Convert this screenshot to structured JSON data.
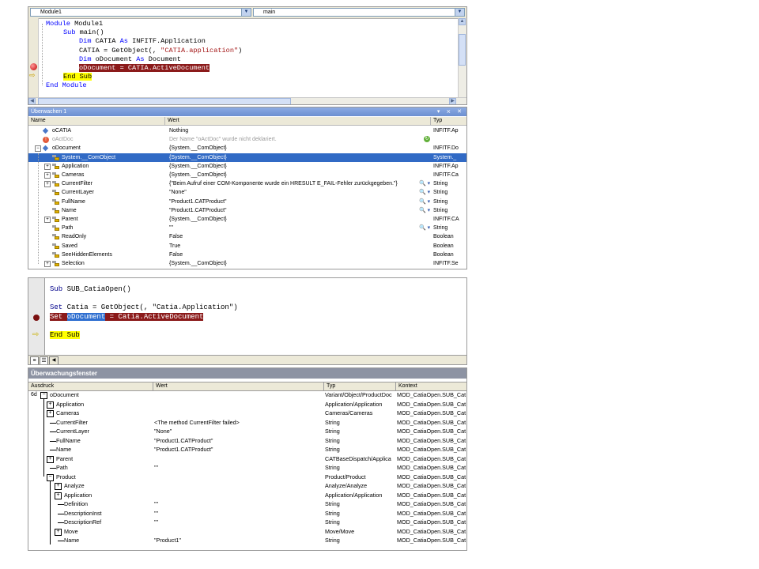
{
  "vs_editor": {
    "class_combo": "Module1",
    "method_combo": "main",
    "lines": [
      {
        "indent": 0,
        "parts": [
          [
            "kw",
            "Module"
          ],
          [
            "t",
            " Module1"
          ]
        ]
      },
      {
        "indent": 1,
        "parts": [
          [
            "kw",
            "Sub"
          ],
          [
            "t",
            " main()"
          ]
        ]
      },
      {
        "indent": 2,
        "parts": [
          [
            "kw",
            "Dim"
          ],
          [
            "t",
            " CATIA "
          ],
          [
            "kw",
            "As"
          ],
          [
            "t",
            " INFITF.Application"
          ]
        ]
      },
      {
        "indent": 2,
        "parts": [
          [
            "t",
            "CATIA = GetObject(, "
          ],
          [
            "str",
            "\"CATIA.application\""
          ],
          [
            "t",
            ")"
          ]
        ]
      },
      {
        "indent": 2,
        "parts": [
          [
            "kw",
            "Dim"
          ],
          [
            "t",
            " oDocument "
          ],
          [
            "kw",
            "As"
          ],
          [
            "t",
            " Document"
          ]
        ]
      },
      {
        "indent": 2,
        "parts": [
          [
            "bp",
            "oDocument = CATIA.ActiveDocument"
          ]
        ]
      },
      {
        "indent": 1,
        "parts": [
          [
            "cur",
            "End Sub"
          ]
        ]
      },
      {
        "indent": 0,
        "parts": [
          [
            "kw",
            "End Module"
          ]
        ]
      }
    ]
  },
  "watch1": {
    "title": "Überwachen 1",
    "title_icons": "▾ ⨯ ✕",
    "columns": {
      "name": "Name",
      "value": "Wert",
      "type": "Typ"
    },
    "rows": [
      {
        "level": 0,
        "expander": "",
        "icon": "obj",
        "name": "oCATIA",
        "value": "Nothing",
        "type": "INFITF.Ap",
        "gray": false,
        "sel": false,
        "mag": false
      },
      {
        "level": 0,
        "expander": "",
        "icon": "err",
        "name": "oActDoc",
        "value": "Der Name \"oActDoc\" wurde nicht deklariert.",
        "type": "",
        "gray": true,
        "sel": false,
        "mag": false,
        "refresh": true
      },
      {
        "level": 0,
        "expander": "−",
        "icon": "obj",
        "name": "oDocument",
        "value": "{System.__ComObject}",
        "type": "INFITF.Do",
        "gray": false,
        "sel": false,
        "mag": false
      },
      {
        "level": 1,
        "expander": "",
        "icon": "prop",
        "name": "System.__ComObject",
        "value": "{System.__ComObject}",
        "type": "System._",
        "gray": false,
        "sel": true,
        "mag": false
      },
      {
        "level": 1,
        "expander": "+",
        "icon": "prop",
        "name": "Application",
        "value": "{System.__ComObject}",
        "type": "INFITF.Ap",
        "gray": false,
        "sel": false,
        "mag": false
      },
      {
        "level": 1,
        "expander": "+",
        "icon": "prop",
        "name": "Cameras",
        "value": "{System.__ComObject}",
        "type": "INFITF.Ca",
        "gray": false,
        "sel": false,
        "mag": false
      },
      {
        "level": 1,
        "expander": "+",
        "icon": "prop",
        "name": "CurrentFilter",
        "value": "{\"Beim Aufruf einer COM-Komponente wurde ein HRESULT E_FAIL-Fehler zurückgegeben.\"}",
        "type": "String",
        "gray": false,
        "sel": false,
        "mag": true
      },
      {
        "level": 1,
        "expander": "",
        "icon": "prop",
        "name": "CurrentLayer",
        "value": "\"None\"",
        "type": "String",
        "gray": false,
        "sel": false,
        "mag": true
      },
      {
        "level": 1,
        "expander": "",
        "icon": "prop",
        "name": "FullName",
        "value": "\"Product1.CATProduct\"",
        "type": "String",
        "gray": false,
        "sel": false,
        "mag": true
      },
      {
        "level": 1,
        "expander": "",
        "icon": "prop",
        "name": "Name",
        "value": "\"Product1.CATProduct\"",
        "type": "String",
        "gray": false,
        "sel": false,
        "mag": true
      },
      {
        "level": 1,
        "expander": "+",
        "icon": "prop",
        "name": "Parent",
        "value": "{System.__ComObject}",
        "type": "INFITF.CA",
        "gray": false,
        "sel": false,
        "mag": false
      },
      {
        "level": 1,
        "expander": "",
        "icon": "prop",
        "name": "Path",
        "value": "\"\"",
        "type": "String",
        "gray": false,
        "sel": false,
        "mag": true
      },
      {
        "level": 1,
        "expander": "",
        "icon": "prop",
        "name": "ReadOnly",
        "value": "False",
        "type": "Boolean",
        "gray": false,
        "sel": false,
        "mag": false
      },
      {
        "level": 1,
        "expander": "",
        "icon": "prop",
        "name": "Saved",
        "value": "True",
        "type": "Boolean",
        "gray": false,
        "sel": false,
        "mag": false
      },
      {
        "level": 1,
        "expander": "",
        "icon": "prop",
        "name": "SeeHiddenElements",
        "value": "False",
        "type": "Boolean",
        "gray": false,
        "sel": false,
        "mag": false
      },
      {
        "level": 1,
        "expander": "+",
        "icon": "prop",
        "name": "Selection",
        "value": "{System.__ComObject}",
        "type": "INFITF.Se",
        "gray": false,
        "sel": false,
        "mag": false
      }
    ],
    "mag_glyph": "🔍 ▾"
  },
  "vba_editor": {
    "lines": [
      {
        "parts": [
          [
            "vkw",
            "Sub"
          ],
          [
            "t",
            " SUB_CatiaOpen()"
          ]
        ]
      },
      {
        "parts": []
      },
      {
        "parts": [
          [
            "vkw",
            "Set"
          ],
          [
            "t",
            " Catia = GetObject(, \"Catia.Application\")"
          ]
        ]
      },
      {
        "parts": [
          [
            "vbp",
            "Set "
          ],
          [
            "vsel",
            "oDocument"
          ],
          [
            "vbp",
            " = Catia.ActiveDocument"
          ]
        ]
      },
      {
        "parts": []
      },
      {
        "parts": [
          [
            "vcur",
            "End Sub"
          ]
        ]
      }
    ]
  },
  "watch2": {
    "title": "Überwachungsfenster",
    "columns": {
      "expr": "Ausdruck",
      "value": "Wert",
      "type": "Typ",
      "context": "Kontext"
    },
    "rows": [
      {
        "level": 0,
        "box": "−",
        "name": "oDocument",
        "value": "",
        "type": "Variant/Object/ProductDoc",
        "context": "MOD_CatiaOpen.SUB_Cat"
      },
      {
        "level": 1,
        "box": "+",
        "name": "Application",
        "value": "",
        "type": "Application/Application",
        "context": "MOD_CatiaOpen.SUB_Cat"
      },
      {
        "level": 1,
        "box": "+",
        "name": "Cameras",
        "value": "",
        "type": "Cameras/Cameras",
        "context": "MOD_CatiaOpen.SUB_Cat"
      },
      {
        "level": 1,
        "box": "",
        "name": "CurrentFilter",
        "value": "<The method CurrentFilter failed>",
        "type": "String",
        "context": "MOD_CatiaOpen.SUB_Cat"
      },
      {
        "level": 1,
        "box": "",
        "name": "CurrentLayer",
        "value": "\"None\"",
        "type": "String",
        "context": "MOD_CatiaOpen.SUB_Cat"
      },
      {
        "level": 1,
        "box": "",
        "name": "FullName",
        "value": "\"Product1.CATProduct\"",
        "type": "String",
        "context": "MOD_CatiaOpen.SUB_Cat"
      },
      {
        "level": 1,
        "box": "",
        "name": "Name",
        "value": "\"Product1.CATProduct\"",
        "type": "String",
        "context": "MOD_CatiaOpen.SUB_Cat"
      },
      {
        "level": 1,
        "box": "+",
        "name": "Parent",
        "value": "",
        "type": "CATBaseDispatch/Applica",
        "context": "MOD_CatiaOpen.SUB_Cat"
      },
      {
        "level": 1,
        "box": "",
        "name": "Path",
        "value": "\"\"",
        "type": "String",
        "context": "MOD_CatiaOpen.SUB_Cat"
      },
      {
        "level": 1,
        "box": "−",
        "name": "Product",
        "value": "",
        "type": "Product/Product",
        "context": "MOD_CatiaOpen.SUB_Cat"
      },
      {
        "level": 2,
        "box": "+",
        "name": "Analyze",
        "value": "",
        "type": "Analyze/Analyze",
        "context": "MOD_CatiaOpen.SUB_Cat"
      },
      {
        "level": 2,
        "box": "+",
        "name": "Application",
        "value": "",
        "type": "Application/Application",
        "context": "MOD_CatiaOpen.SUB_Cat"
      },
      {
        "level": 2,
        "box": "",
        "name": "Definition",
        "value": "\"\"",
        "type": "String",
        "context": "MOD_CatiaOpen.SUB_Cat"
      },
      {
        "level": 2,
        "box": "",
        "name": "DescriptionInst",
        "value": "\"\"",
        "type": "String",
        "context": "MOD_CatiaOpen.SUB_Cat"
      },
      {
        "level": 2,
        "box": "",
        "name": "DescriptionRef",
        "value": "\"\"",
        "type": "String",
        "context": "MOD_CatiaOpen.SUB_Cat"
      },
      {
        "level": 2,
        "box": "+",
        "name": "Move",
        "value": "",
        "type": "Move/Move",
        "context": "MOD_CatiaOpen.SUB_Cat"
      },
      {
        "level": 2,
        "box": "",
        "name": "Name",
        "value": "\"Product1\"",
        "type": "String",
        "context": "MOD_CatiaOpen.SUB_Cat"
      }
    ]
  }
}
